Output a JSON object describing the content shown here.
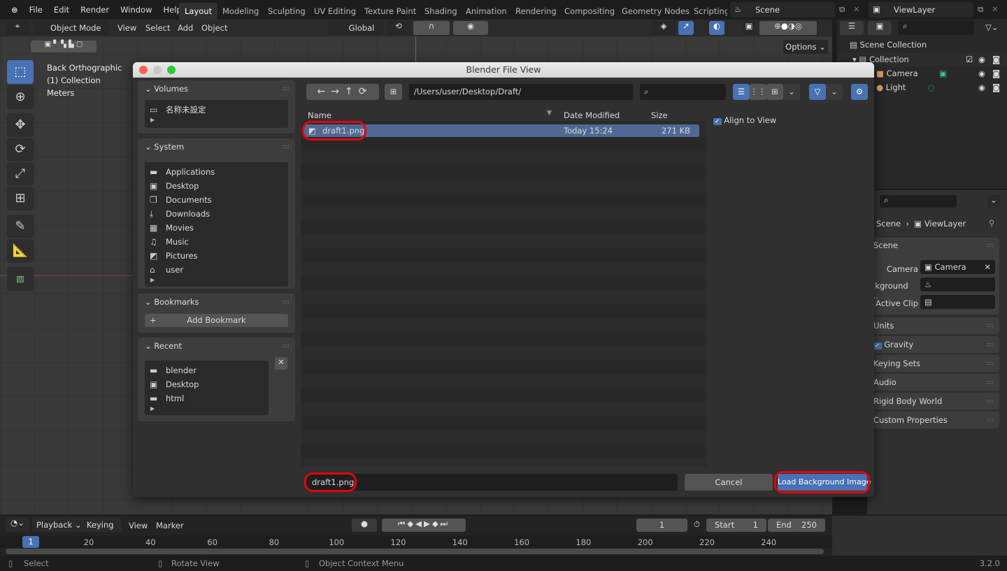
{
  "menubar": {
    "items": [
      "File",
      "Edit",
      "Render",
      "Window",
      "Help"
    ],
    "workspaces": [
      "Layout",
      "Modeling",
      "Sculpting",
      "UV Editing",
      "Texture Paint",
      "Shading",
      "Animation",
      "Rendering",
      "Compositing",
      "Geometry Nodes",
      "Scripting"
    ],
    "active_workspace": "Layout",
    "scene": "Scene",
    "view_layer": "ViewLayer"
  },
  "viewport": {
    "mode": "Object Mode",
    "menus": [
      "View",
      "Select",
      "Add",
      "Object"
    ],
    "orientation": "Global",
    "options": "Options",
    "overlay_lines": [
      "Back Orthographic",
      "(1) Collection",
      "Meters"
    ]
  },
  "outliner": {
    "root": "Scene Collection",
    "collection": "Collection",
    "items": [
      "Camera",
      "Light"
    ]
  },
  "properties": {
    "breadcrumb_scene": "Scene",
    "breadcrumb_layer": "ViewLayer",
    "panel_scene": "Scene",
    "camera_label": "Camera",
    "camera_value": "Camera",
    "background_label": "ckground ...",
    "active_clip_label": "Active Clip",
    "panels": [
      "Units",
      "Gravity",
      "Keying Sets",
      "Audio",
      "Rigid Body World",
      "Custom Properties"
    ],
    "gravity_checked": true
  },
  "dialog": {
    "title": "Blender File View",
    "path": "/Users/user/Desktop/Draft/",
    "search_placeholder": "",
    "volumes": {
      "title": "Volumes",
      "items": [
        "名称未設定"
      ]
    },
    "system": {
      "title": "System",
      "items": [
        "Applications",
        "Desktop",
        "Documents",
        "Downloads",
        "Movies",
        "Music",
        "Pictures",
        "user"
      ]
    },
    "bookmarks": {
      "title": "Bookmarks",
      "add": "Add Bookmark"
    },
    "recent": {
      "title": "Recent",
      "items": [
        "blender",
        "Desktop",
        "html"
      ]
    },
    "columns": [
      "Name",
      "Date Modified",
      "Size"
    ],
    "files": [
      {
        "name": "draft1.png",
        "date": "Today 15:24",
        "size": "271 KB",
        "selected": true
      }
    ],
    "align_to_view": "Align to View",
    "align_checked": true,
    "filename": "draft1.png",
    "cancel": "Cancel",
    "confirm": "Load Background Image"
  },
  "timeline": {
    "menus": [
      "Playback",
      "Keying",
      "View",
      "Marker"
    ],
    "current_frame": "1",
    "start_label": "Start",
    "start": "1",
    "end_label": "End",
    "end": "250",
    "ticks": [
      "20",
      "40",
      "60",
      "80",
      "100",
      "120",
      "140",
      "160",
      "180",
      "200",
      "220",
      "240"
    ],
    "playhead": "1"
  },
  "status": {
    "items": [
      "Select",
      "Rotate View",
      "Object Context Menu"
    ],
    "version": "3.2.0"
  },
  "colors": {
    "accent": "#4772b3",
    "highlight": "#e8000c"
  }
}
